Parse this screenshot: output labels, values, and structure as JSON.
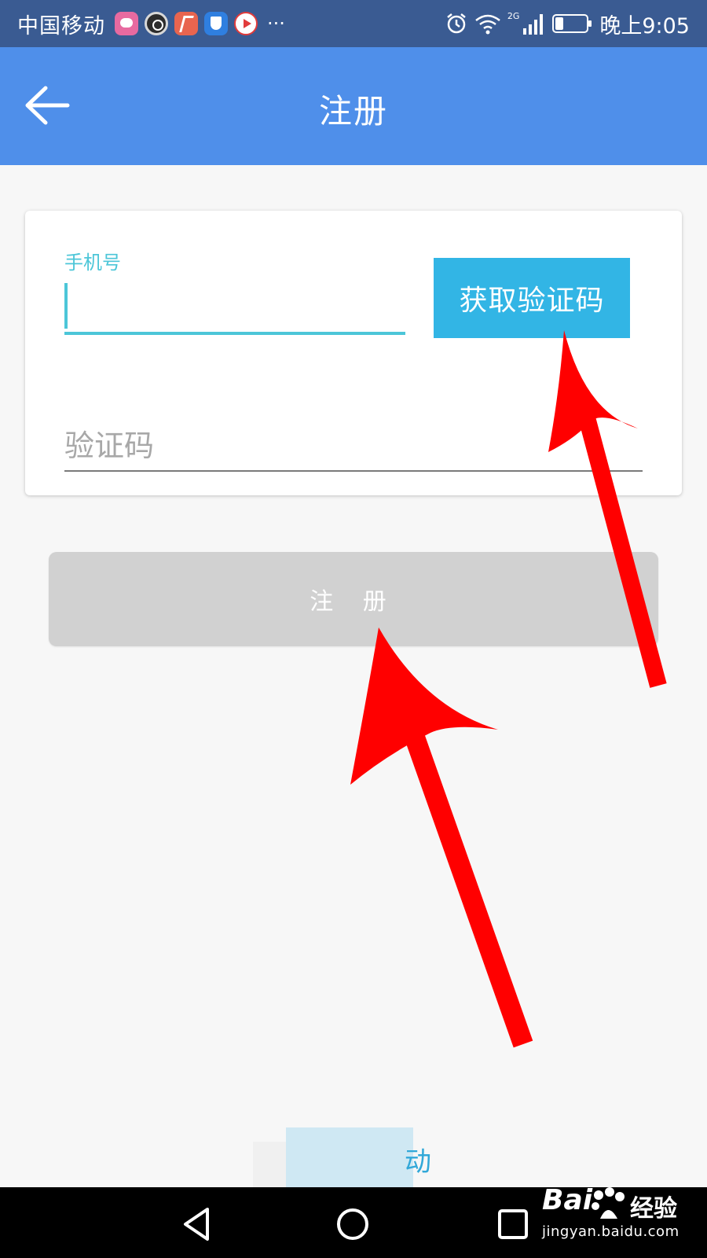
{
  "status_bar": {
    "carrier": "中国移动",
    "overflow_indicator": "···",
    "network_label": "2G",
    "time": "晚上9:05",
    "icons": [
      "app-notification-icon",
      "camera-icon",
      "sports-app-icon",
      "shield-icon",
      "video-play-icon",
      "alarm-icon",
      "wifi-icon",
      "signal-icon",
      "battery-icon"
    ]
  },
  "app_bar": {
    "title": "注册",
    "back_icon": "arrow-left-icon"
  },
  "form": {
    "phone_label": "手机号",
    "phone_value": "",
    "get_code_button": "获取验证码",
    "code_placeholder": "验证码",
    "accent_color": "#4cc6d8",
    "button_color": "#32b5e5"
  },
  "register_button": {
    "label": "注 册",
    "state": "disabled",
    "color": "#d1d1d1"
  },
  "bottom_link": {
    "visible_text": "动"
  },
  "nav_bar": {
    "icons": [
      "back-triangle-icon",
      "home-circle-icon",
      "recent-square-icon"
    ]
  },
  "watermark": {
    "logo": "Bai",
    "suffix": "经验",
    "url": "jingyan.baidu.com"
  },
  "colors": {
    "status_bar": "#3a5b92",
    "app_bar": "#4f8fea",
    "background": "#f7f7f7",
    "annotation_arrows": "#ff0000"
  }
}
